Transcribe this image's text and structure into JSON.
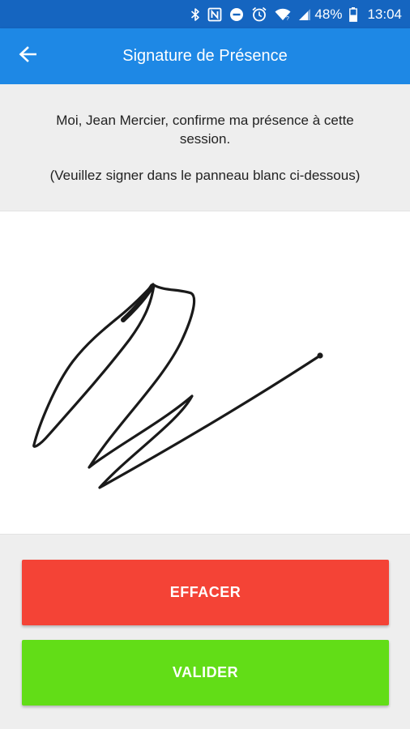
{
  "status_bar": {
    "icons": [
      "bluetooth-icon",
      "nfc-icon",
      "do-not-disturb-icon",
      "alarm-icon",
      "wifi-icon",
      "signal-icon",
      "battery-icon"
    ],
    "battery": "48%",
    "time": "13:04"
  },
  "app_bar": {
    "back_icon": "arrow-back-icon",
    "title": "Signature de Présence"
  },
  "message": {
    "confirmation": "Moi, Jean Mercier, confirme ma présence à cette session.",
    "instruction": "(Veuillez signer dans le panneau blanc ci-dessous)"
  },
  "signature_pad": {
    "background": "#ffffff",
    "stroke_color": "#1a1a1a"
  },
  "buttons": {
    "clear_label": "EFFACER",
    "validate_label": "VALIDER"
  },
  "colors": {
    "status_bar": "#1565c0",
    "app_bar": "#1e88e5",
    "clear": "#f44336",
    "validate": "#62dd17"
  }
}
